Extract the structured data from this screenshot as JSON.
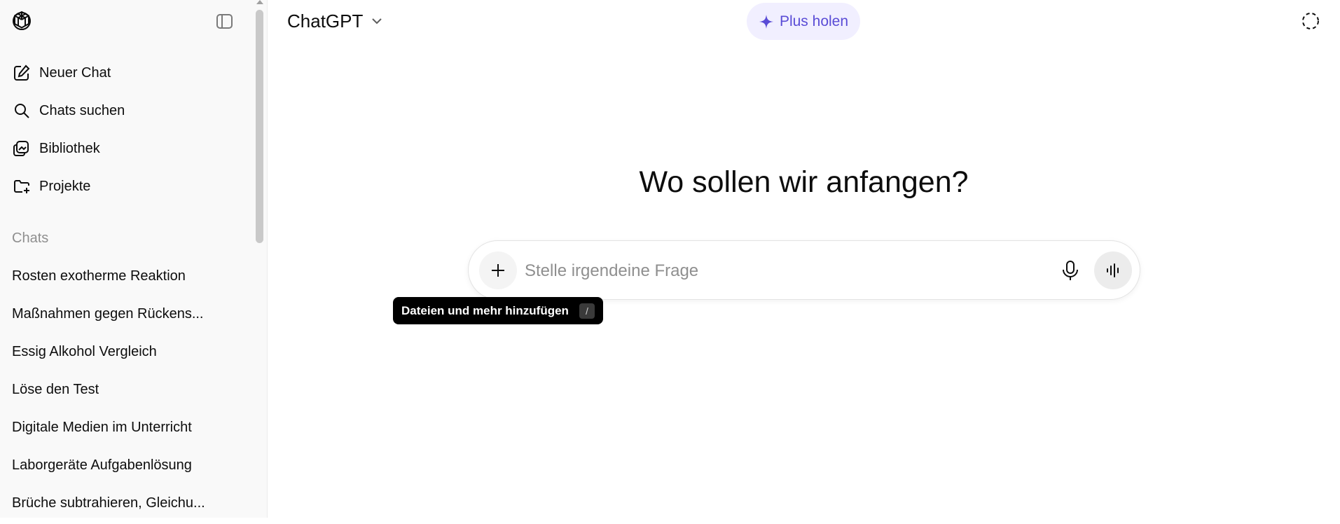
{
  "sidebar": {
    "nav": [
      {
        "label": "Neuer Chat",
        "icon": "edit-icon"
      },
      {
        "label": "Chats suchen",
        "icon": "search-icon"
      },
      {
        "label": "Bibliothek",
        "icon": "library-icon"
      },
      {
        "label": "Projekte",
        "icon": "folder-plus-icon"
      }
    ],
    "section_label": "Chats",
    "chats": [
      "Rosten exotherme Reaktion",
      "Maßnahmen gegen Rückens...",
      "Essig Alkohol Vergleich",
      "Löse den Test",
      "Digitale Medien im Unterricht",
      "Laborgeräte Aufgabenlösung",
      "Brüche subtrahieren, Gleichu..."
    ]
  },
  "header": {
    "model_name": "ChatGPT",
    "upgrade_label": "Plus holen"
  },
  "main": {
    "heading": "Wo sollen wir anfangen?",
    "composer": {
      "placeholder": "Stelle irgendeine Frage"
    },
    "tooltip": {
      "text": "Dateien und mehr hinzufügen",
      "shortcut": "/"
    }
  },
  "colors": {
    "accent": "#5a4cd6",
    "upgrade_bg": "#f1efff",
    "sidebar_bg": "#f9f9f9"
  }
}
